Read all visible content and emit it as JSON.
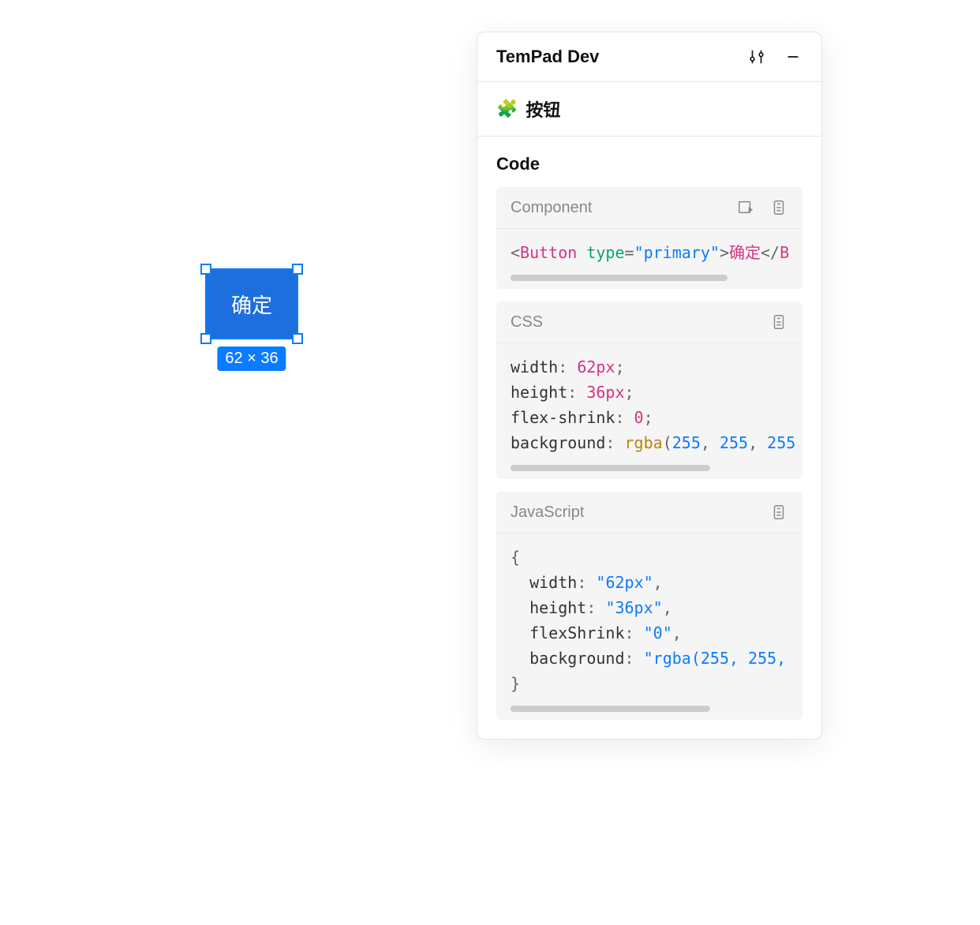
{
  "panel": {
    "title": "TemPad Dev",
    "subheader": "按钮",
    "section_title": "Code"
  },
  "canvas": {
    "button_label": "确定",
    "size_badge": "62 × 36"
  },
  "codePanels": {
    "component": {
      "title": "Component",
      "code": {
        "tag": "Button",
        "attr_name": "type",
        "attr_value": "\"primary\"",
        "inner_text": "确定",
        "close_prefix": "B"
      },
      "scrollbar_width": "78%"
    },
    "css": {
      "title": "CSS",
      "lines": [
        {
          "prop": "width",
          "value": "62px"
        },
        {
          "prop": "height",
          "value": "36px"
        },
        {
          "prop": "flex-shrink",
          "value": "0"
        },
        {
          "prop": "background",
          "func": "rgba",
          "args": [
            "255",
            "255",
            "255"
          ]
        }
      ],
      "scrollbar_width": "72%"
    },
    "js": {
      "title": "JavaScript",
      "open": "{",
      "close": "}",
      "lines": [
        {
          "key": "width",
          "val": "\"62px\""
        },
        {
          "key": "height",
          "val": "\"36px\""
        },
        {
          "key": "flexShrink",
          "val": "\"0\""
        },
        {
          "key": "background",
          "val": "\"rgba(255, 255,"
        }
      ],
      "scrollbar_width": "72%"
    }
  }
}
